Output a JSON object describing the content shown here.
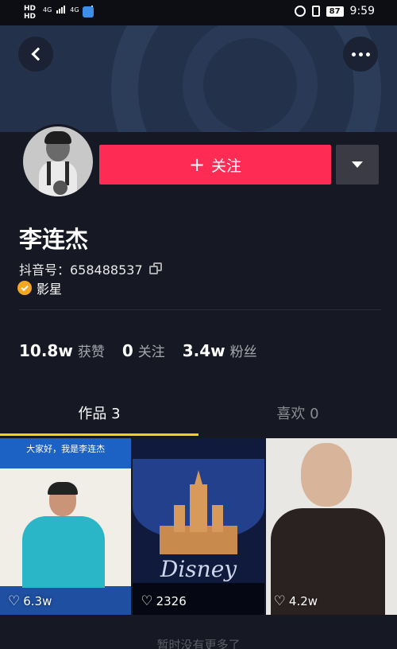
{
  "status_bar": {
    "hd_top": "HD",
    "hd_bottom": "HD",
    "net1": "4G",
    "net2": "4G",
    "battery": "87",
    "time": "9:59"
  },
  "profile": {
    "name": "李连杰",
    "douyin_id": "抖音号：658488537",
    "verified_label": "影星",
    "follow_label": "关注",
    "stats": [
      {
        "value": "10.8w",
        "label": "获赞"
      },
      {
        "value": "0",
        "label": "关注"
      },
      {
        "value": "3.4w",
        "label": "粉丝"
      }
    ]
  },
  "tabs": [
    {
      "label": "作品 3",
      "active": true
    },
    {
      "label": "喜欢 0",
      "active": false
    }
  ],
  "videos": [
    {
      "overlay_text": "大家好，我是李连杰",
      "likes": "6.3w"
    },
    {
      "overlay_text": "Disney",
      "likes": "2326"
    },
    {
      "likes": "4.2w"
    }
  ],
  "footer_text": "暂时没有更多了",
  "colors": {
    "background": "#161823",
    "accent": "#fe2c55",
    "tab_indicator": "#face15",
    "verified": "#f5a623"
  },
  "icons": [
    "back-icon",
    "more-icon",
    "plus-icon",
    "dropdown-icon",
    "copy-icon",
    "verified-icon",
    "heart-icon"
  ]
}
